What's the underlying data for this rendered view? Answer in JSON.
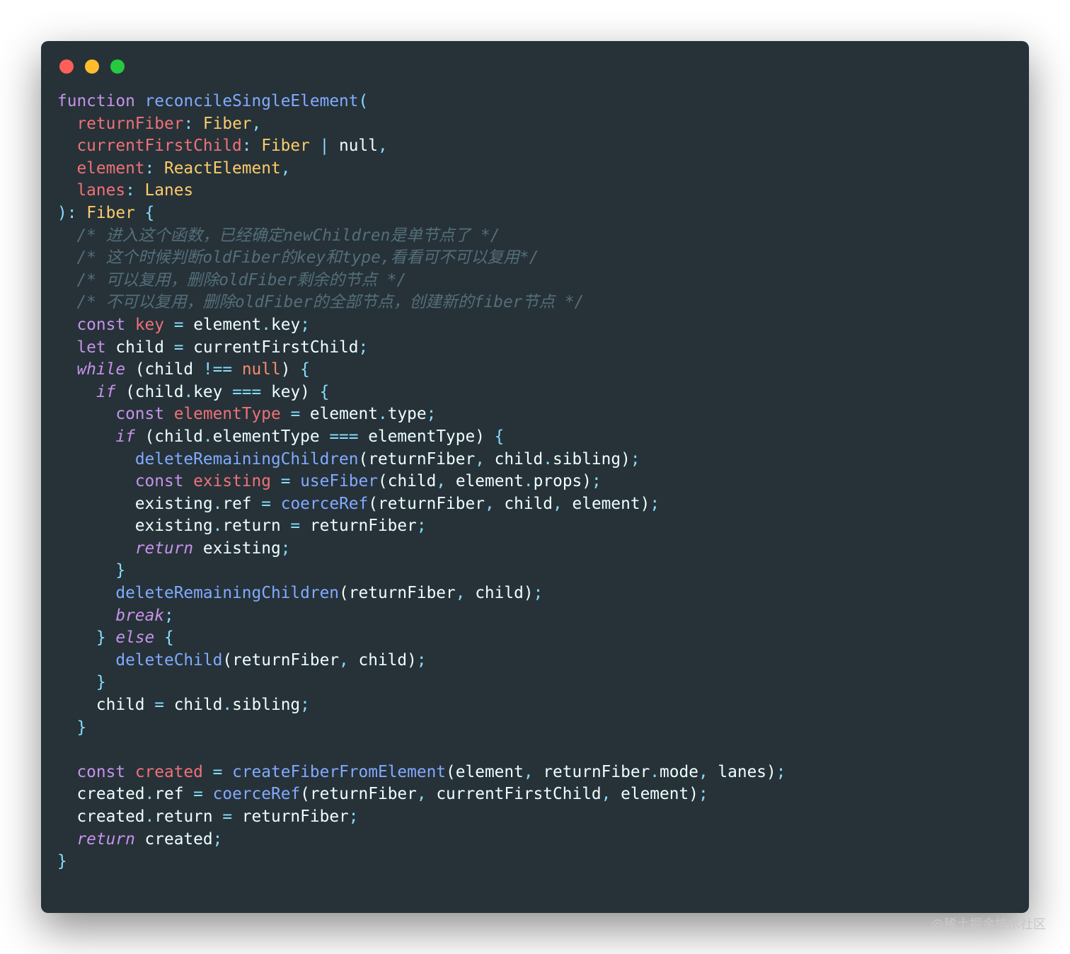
{
  "window": {
    "controls": [
      {
        "name": "close",
        "color": "#ff5f56"
      },
      {
        "name": "minimize",
        "color": "#ffbd2e"
      },
      {
        "name": "maximize",
        "color": "#27c93f"
      }
    ],
    "background": "#263238"
  },
  "theme": {
    "keyword": "#c792ea",
    "function": "#82aaff",
    "param": "#f07178",
    "type": "#ffcb6b",
    "number_null": "#f78c6c",
    "operator": "#89ddff",
    "comment": "#546e7a",
    "text": "#eeffff"
  },
  "code": [
    [
      [
        "kw",
        "function"
      ],
      [
        "tx",
        " "
      ],
      [
        "fn",
        "reconcileSingleElement"
      ],
      [
        "pu",
        "("
      ]
    ],
    [
      [
        "tx",
        "  "
      ],
      [
        "pn",
        "returnFiber"
      ],
      [
        "pu",
        ": "
      ],
      [
        "ty",
        "Fiber"
      ],
      [
        "pu",
        ","
      ]
    ],
    [
      [
        "tx",
        "  "
      ],
      [
        "pn",
        "currentFirstChild"
      ],
      [
        "pu",
        ": "
      ],
      [
        "ty",
        "Fiber"
      ],
      [
        "tx",
        " "
      ],
      [
        "op",
        "|"
      ],
      [
        "tx",
        " null"
      ],
      [
        "pu",
        ","
      ]
    ],
    [
      [
        "tx",
        "  "
      ],
      [
        "pn",
        "element"
      ],
      [
        "pu",
        ": "
      ],
      [
        "ty",
        "ReactElement"
      ],
      [
        "pu",
        ","
      ]
    ],
    [
      [
        "tx",
        "  "
      ],
      [
        "pn",
        "lanes"
      ],
      [
        "pu",
        ": "
      ],
      [
        "ty",
        "Lanes"
      ]
    ],
    [
      [
        "pu",
        "): "
      ],
      [
        "ty",
        "Fiber"
      ],
      [
        "tx",
        " "
      ],
      [
        "pu",
        "{"
      ]
    ],
    [
      [
        "tx",
        "  "
      ],
      [
        "cm",
        "/* 进入这个函数，已经确定newChildren是单节点了 */"
      ]
    ],
    [
      [
        "tx",
        "  "
      ],
      [
        "cm",
        "/* 这个时候判断oldFiber的key和type,看看可不可以复用*/"
      ]
    ],
    [
      [
        "tx",
        "  "
      ],
      [
        "cm",
        "/* 可以复用，删除oldFiber剩余的节点 */"
      ]
    ],
    [
      [
        "tx",
        "  "
      ],
      [
        "cm",
        "/* 不可以复用，删除oldFiber的全部节点，创建新的fiber节点 */"
      ]
    ],
    [
      [
        "tx",
        "  "
      ],
      [
        "kw",
        "const"
      ],
      [
        "tx",
        " "
      ],
      [
        "pn",
        "key"
      ],
      [
        "tx",
        " "
      ],
      [
        "op",
        "="
      ],
      [
        "tx",
        " element"
      ],
      [
        "op",
        "."
      ],
      [
        "tx",
        "key"
      ],
      [
        "pu",
        ";"
      ]
    ],
    [
      [
        "tx",
        "  "
      ],
      [
        "kw",
        "let"
      ],
      [
        "tx",
        " child "
      ],
      [
        "op",
        "="
      ],
      [
        "tx",
        " currentFirstChild"
      ],
      [
        "pu",
        ";"
      ]
    ],
    [
      [
        "tx",
        "  "
      ],
      [
        "ct",
        "while"
      ],
      [
        "tx",
        " (child "
      ],
      [
        "op",
        "!=="
      ],
      [
        "tx",
        " "
      ],
      [
        "vd",
        "null"
      ],
      [
        "tx",
        ") "
      ],
      [
        "pu",
        "{"
      ]
    ],
    [
      [
        "tx",
        "    "
      ],
      [
        "ct",
        "if"
      ],
      [
        "tx",
        " (child"
      ],
      [
        "op",
        "."
      ],
      [
        "tx",
        "key "
      ],
      [
        "op",
        "==="
      ],
      [
        "tx",
        " key) "
      ],
      [
        "pu",
        "{"
      ]
    ],
    [
      [
        "tx",
        "      "
      ],
      [
        "kw",
        "const"
      ],
      [
        "tx",
        " "
      ],
      [
        "pn",
        "elementType"
      ],
      [
        "tx",
        " "
      ],
      [
        "op",
        "="
      ],
      [
        "tx",
        " element"
      ],
      [
        "op",
        "."
      ],
      [
        "tx",
        "type"
      ],
      [
        "pu",
        ";"
      ]
    ],
    [
      [
        "tx",
        "      "
      ],
      [
        "ct",
        "if"
      ],
      [
        "tx",
        " (child"
      ],
      [
        "op",
        "."
      ],
      [
        "tx",
        "elementType "
      ],
      [
        "op",
        "==="
      ],
      [
        "tx",
        " elementType) "
      ],
      [
        "pu",
        "{"
      ]
    ],
    [
      [
        "tx",
        "        "
      ],
      [
        "fn",
        "deleteRemainingChildren"
      ],
      [
        "tx",
        "(returnFiber"
      ],
      [
        "pu",
        ","
      ],
      [
        "tx",
        " child"
      ],
      [
        "op",
        "."
      ],
      [
        "tx",
        "sibling)"
      ],
      [
        "pu",
        ";"
      ]
    ],
    [
      [
        "tx",
        "        "
      ],
      [
        "kw",
        "const"
      ],
      [
        "tx",
        " "
      ],
      [
        "pn",
        "existing"
      ],
      [
        "tx",
        " "
      ],
      [
        "op",
        "="
      ],
      [
        "tx",
        " "
      ],
      [
        "fn",
        "useFiber"
      ],
      [
        "tx",
        "(child"
      ],
      [
        "pu",
        ","
      ],
      [
        "tx",
        " element"
      ],
      [
        "op",
        "."
      ],
      [
        "tx",
        "props)"
      ],
      [
        "pu",
        ";"
      ]
    ],
    [
      [
        "tx",
        "        existing"
      ],
      [
        "op",
        "."
      ],
      [
        "tx",
        "ref "
      ],
      [
        "op",
        "="
      ],
      [
        "tx",
        " "
      ],
      [
        "fn",
        "coerceRef"
      ],
      [
        "tx",
        "(returnFiber"
      ],
      [
        "pu",
        ","
      ],
      [
        "tx",
        " child"
      ],
      [
        "pu",
        ","
      ],
      [
        "tx",
        " element)"
      ],
      [
        "pu",
        ";"
      ]
    ],
    [
      [
        "tx",
        "        existing"
      ],
      [
        "op",
        "."
      ],
      [
        "tx",
        "return "
      ],
      [
        "op",
        "="
      ],
      [
        "tx",
        " returnFiber"
      ],
      [
        "pu",
        ";"
      ]
    ],
    [
      [
        "tx",
        "        "
      ],
      [
        "ct",
        "return"
      ],
      [
        "tx",
        " existing"
      ],
      [
        "pu",
        ";"
      ]
    ],
    [
      [
        "tx",
        "      "
      ],
      [
        "pu",
        "}"
      ]
    ],
    [
      [
        "tx",
        "      "
      ],
      [
        "fn",
        "deleteRemainingChildren"
      ],
      [
        "tx",
        "(returnFiber"
      ],
      [
        "pu",
        ","
      ],
      [
        "tx",
        " child)"
      ],
      [
        "pu",
        ";"
      ]
    ],
    [
      [
        "tx",
        "      "
      ],
      [
        "ct",
        "break"
      ],
      [
        "pu",
        ";"
      ]
    ],
    [
      [
        "tx",
        "    "
      ],
      [
        "pu",
        "}"
      ],
      [
        "tx",
        " "
      ],
      [
        "ct",
        "else"
      ],
      [
        "tx",
        " "
      ],
      [
        "pu",
        "{"
      ]
    ],
    [
      [
        "tx",
        "      "
      ],
      [
        "fn",
        "deleteChild"
      ],
      [
        "tx",
        "(returnFiber"
      ],
      [
        "pu",
        ","
      ],
      [
        "tx",
        " child)"
      ],
      [
        "pu",
        ";"
      ]
    ],
    [
      [
        "tx",
        "    "
      ],
      [
        "pu",
        "}"
      ]
    ],
    [
      [
        "tx",
        "    child "
      ],
      [
        "op",
        "="
      ],
      [
        "tx",
        " child"
      ],
      [
        "op",
        "."
      ],
      [
        "tx",
        "sibling"
      ],
      [
        "pu",
        ";"
      ]
    ],
    [
      [
        "tx",
        "  "
      ],
      [
        "pu",
        "}"
      ]
    ],
    [
      [
        "tx",
        ""
      ]
    ],
    [
      [
        "tx",
        "  "
      ],
      [
        "kw",
        "const"
      ],
      [
        "tx",
        " "
      ],
      [
        "pn",
        "created"
      ],
      [
        "tx",
        " "
      ],
      [
        "op",
        "="
      ],
      [
        "tx",
        " "
      ],
      [
        "fn",
        "createFiberFromElement"
      ],
      [
        "tx",
        "(element"
      ],
      [
        "pu",
        ","
      ],
      [
        "tx",
        " returnFiber"
      ],
      [
        "op",
        "."
      ],
      [
        "tx",
        "mode"
      ],
      [
        "pu",
        ","
      ],
      [
        "tx",
        " lanes)"
      ],
      [
        "pu",
        ";"
      ]
    ],
    [
      [
        "tx",
        "  created"
      ],
      [
        "op",
        "."
      ],
      [
        "tx",
        "ref "
      ],
      [
        "op",
        "="
      ],
      [
        "tx",
        " "
      ],
      [
        "fn",
        "coerceRef"
      ],
      [
        "tx",
        "(returnFiber"
      ],
      [
        "pu",
        ","
      ],
      [
        "tx",
        " currentFirstChild"
      ],
      [
        "pu",
        ","
      ],
      [
        "tx",
        " element)"
      ],
      [
        "pu",
        ";"
      ]
    ],
    [
      [
        "tx",
        "  created"
      ],
      [
        "op",
        "."
      ],
      [
        "tx",
        "return "
      ],
      [
        "op",
        "="
      ],
      [
        "tx",
        " returnFiber"
      ],
      [
        "pu",
        ";"
      ]
    ],
    [
      [
        "tx",
        "  "
      ],
      [
        "ct",
        "return"
      ],
      [
        "tx",
        " created"
      ],
      [
        "pu",
        ";"
      ]
    ],
    [
      [
        "pu",
        "}"
      ]
    ]
  ],
  "watermark": "@稀土掘金技术社区"
}
